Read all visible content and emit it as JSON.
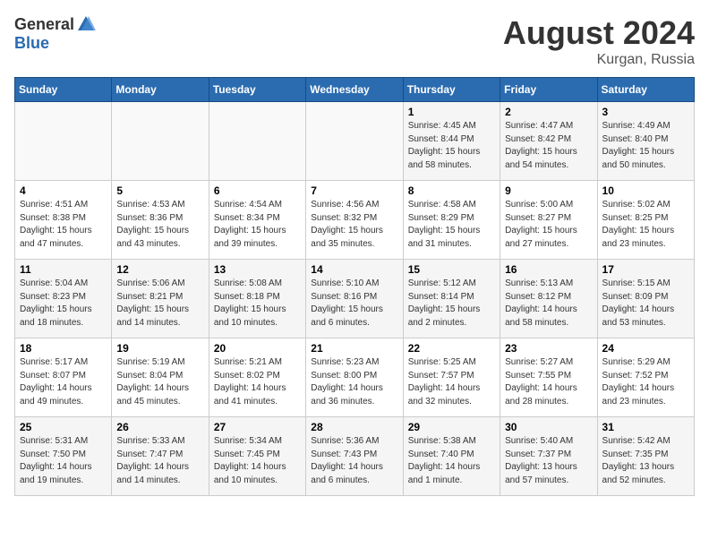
{
  "header": {
    "logo_general": "General",
    "logo_blue": "Blue",
    "month_year": "August 2024",
    "location": "Kurgan, Russia"
  },
  "days_of_week": [
    "Sunday",
    "Monday",
    "Tuesday",
    "Wednesday",
    "Thursday",
    "Friday",
    "Saturday"
  ],
  "weeks": [
    [
      {
        "day": "",
        "sunrise": "",
        "sunset": "",
        "daylight": "",
        "empty": true
      },
      {
        "day": "",
        "sunrise": "",
        "sunset": "",
        "daylight": "",
        "empty": true
      },
      {
        "day": "",
        "sunrise": "",
        "sunset": "",
        "daylight": "",
        "empty": true
      },
      {
        "day": "",
        "sunrise": "",
        "sunset": "",
        "daylight": "",
        "empty": true
      },
      {
        "day": "1",
        "sunrise": "4:45 AM",
        "sunset": "8:44 PM",
        "daylight": "15 hours and 58 minutes.",
        "empty": false
      },
      {
        "day": "2",
        "sunrise": "4:47 AM",
        "sunset": "8:42 PM",
        "daylight": "15 hours and 54 minutes.",
        "empty": false
      },
      {
        "day": "3",
        "sunrise": "4:49 AM",
        "sunset": "8:40 PM",
        "daylight": "15 hours and 50 minutes.",
        "empty": false
      }
    ],
    [
      {
        "day": "4",
        "sunrise": "4:51 AM",
        "sunset": "8:38 PM",
        "daylight": "15 hours and 47 minutes.",
        "empty": false
      },
      {
        "day": "5",
        "sunrise": "4:53 AM",
        "sunset": "8:36 PM",
        "daylight": "15 hours and 43 minutes.",
        "empty": false
      },
      {
        "day": "6",
        "sunrise": "4:54 AM",
        "sunset": "8:34 PM",
        "daylight": "15 hours and 39 minutes.",
        "empty": false
      },
      {
        "day": "7",
        "sunrise": "4:56 AM",
        "sunset": "8:32 PM",
        "daylight": "15 hours and 35 minutes.",
        "empty": false
      },
      {
        "day": "8",
        "sunrise": "4:58 AM",
        "sunset": "8:29 PM",
        "daylight": "15 hours and 31 minutes.",
        "empty": false
      },
      {
        "day": "9",
        "sunrise": "5:00 AM",
        "sunset": "8:27 PM",
        "daylight": "15 hours and 27 minutes.",
        "empty": false
      },
      {
        "day": "10",
        "sunrise": "5:02 AM",
        "sunset": "8:25 PM",
        "daylight": "15 hours and 23 minutes.",
        "empty": false
      }
    ],
    [
      {
        "day": "11",
        "sunrise": "5:04 AM",
        "sunset": "8:23 PM",
        "daylight": "15 hours and 18 minutes.",
        "empty": false
      },
      {
        "day": "12",
        "sunrise": "5:06 AM",
        "sunset": "8:21 PM",
        "daylight": "15 hours and 14 minutes.",
        "empty": false
      },
      {
        "day": "13",
        "sunrise": "5:08 AM",
        "sunset": "8:18 PM",
        "daylight": "15 hours and 10 minutes.",
        "empty": false
      },
      {
        "day": "14",
        "sunrise": "5:10 AM",
        "sunset": "8:16 PM",
        "daylight": "15 hours and 6 minutes.",
        "empty": false
      },
      {
        "day": "15",
        "sunrise": "5:12 AM",
        "sunset": "8:14 PM",
        "daylight": "15 hours and 2 minutes.",
        "empty": false
      },
      {
        "day": "16",
        "sunrise": "5:13 AM",
        "sunset": "8:12 PM",
        "daylight": "14 hours and 58 minutes.",
        "empty": false
      },
      {
        "day": "17",
        "sunrise": "5:15 AM",
        "sunset": "8:09 PM",
        "daylight": "14 hours and 53 minutes.",
        "empty": false
      }
    ],
    [
      {
        "day": "18",
        "sunrise": "5:17 AM",
        "sunset": "8:07 PM",
        "daylight": "14 hours and 49 minutes.",
        "empty": false
      },
      {
        "day": "19",
        "sunrise": "5:19 AM",
        "sunset": "8:04 PM",
        "daylight": "14 hours and 45 minutes.",
        "empty": false
      },
      {
        "day": "20",
        "sunrise": "5:21 AM",
        "sunset": "8:02 PM",
        "daylight": "14 hours and 41 minutes.",
        "empty": false
      },
      {
        "day": "21",
        "sunrise": "5:23 AM",
        "sunset": "8:00 PM",
        "daylight": "14 hours and 36 minutes.",
        "empty": false
      },
      {
        "day": "22",
        "sunrise": "5:25 AM",
        "sunset": "7:57 PM",
        "daylight": "14 hours and 32 minutes.",
        "empty": false
      },
      {
        "day": "23",
        "sunrise": "5:27 AM",
        "sunset": "7:55 PM",
        "daylight": "14 hours and 28 minutes.",
        "empty": false
      },
      {
        "day": "24",
        "sunrise": "5:29 AM",
        "sunset": "7:52 PM",
        "daylight": "14 hours and 23 minutes.",
        "empty": false
      }
    ],
    [
      {
        "day": "25",
        "sunrise": "5:31 AM",
        "sunset": "7:50 PM",
        "daylight": "14 hours and 19 minutes.",
        "empty": false
      },
      {
        "day": "26",
        "sunrise": "5:33 AM",
        "sunset": "7:47 PM",
        "daylight": "14 hours and 14 minutes.",
        "empty": false
      },
      {
        "day": "27",
        "sunrise": "5:34 AM",
        "sunset": "7:45 PM",
        "daylight": "14 hours and 10 minutes.",
        "empty": false
      },
      {
        "day": "28",
        "sunrise": "5:36 AM",
        "sunset": "7:43 PM",
        "daylight": "14 hours and 6 minutes.",
        "empty": false
      },
      {
        "day": "29",
        "sunrise": "5:38 AM",
        "sunset": "7:40 PM",
        "daylight": "14 hours and 1 minute.",
        "empty": false
      },
      {
        "day": "30",
        "sunrise": "5:40 AM",
        "sunset": "7:37 PM",
        "daylight": "13 hours and 57 minutes.",
        "empty": false
      },
      {
        "day": "31",
        "sunrise": "5:42 AM",
        "sunset": "7:35 PM",
        "daylight": "13 hours and 52 minutes.",
        "empty": false
      }
    ]
  ]
}
